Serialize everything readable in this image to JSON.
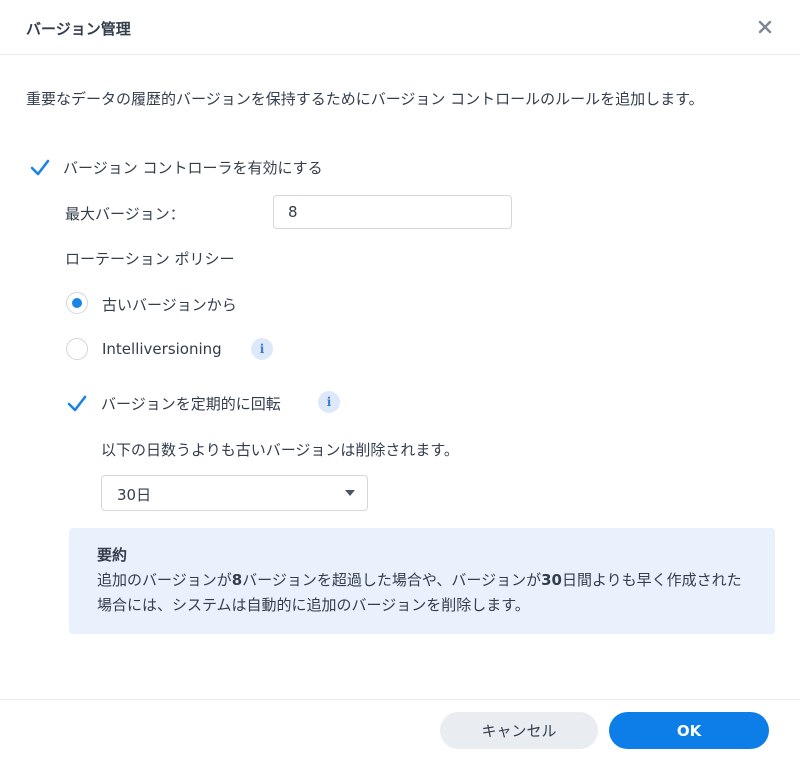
{
  "dialog": {
    "title": "バージョン管理",
    "close_icon": "close-icon"
  },
  "description": "重要なデータの履歴的バージョンを保持するためにバージョン コントロールのルールを追加します。",
  "enable_version_control": {
    "label": "バージョン コントローラを有効にする",
    "checked": true
  },
  "max_versions": {
    "label": "最大バージョン：",
    "value": "8"
  },
  "rotation_policy": {
    "label": "ローテーション ポリシー",
    "options": [
      {
        "label": "古いバージョンから",
        "selected": true
      },
      {
        "label": "Intelliversioning",
        "selected": false
      }
    ],
    "info_icon": "info-icon"
  },
  "periodic_rotation": {
    "label": "バージョンを定期的に回転",
    "checked": true,
    "description": "以下の日数うよりも古いバージョンは削除されます。",
    "selected_period": "30日"
  },
  "summary": {
    "title": "要約",
    "text_part1": "追加のバージョンが",
    "text_bold1": "8",
    "text_part2": "バージョンを超過した場合や、バージョンが",
    "text_bold2": "30",
    "text_part3": "日間よりも早く作成された場合には、システムは自動的に追加のバージョンを削除します。"
  },
  "footer": {
    "cancel_label": "キャンセル",
    "ok_label": "OK"
  },
  "colors": {
    "accent": "#0d7ee8",
    "summary_bg": "#e8f1fc",
    "cancel_bg": "#e9ecf0",
    "text": "#333d4c"
  }
}
